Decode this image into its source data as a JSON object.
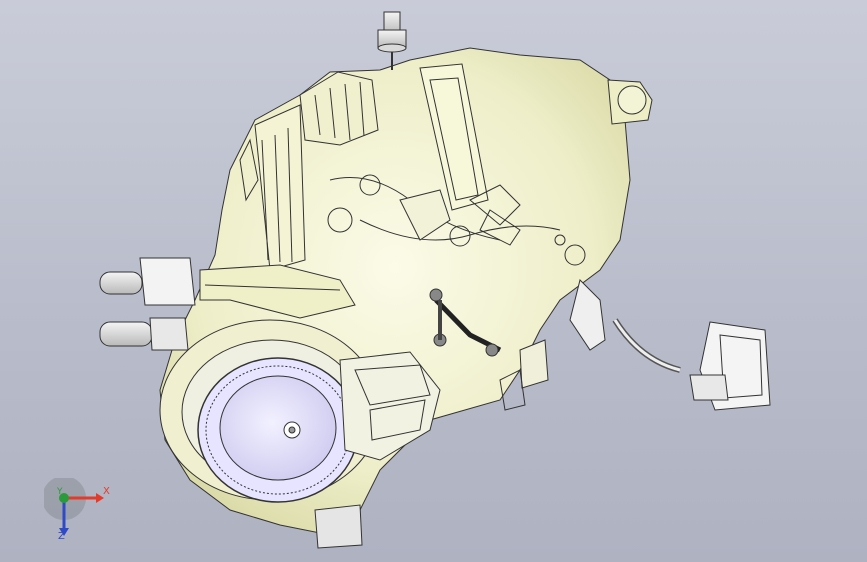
{
  "viewport": {
    "background_top": "#c9ccd8",
    "background_bottom": "#aeb2c1",
    "model_name_icon": "hvac-blower-assembly-icon"
  },
  "triad": {
    "x_label": "X",
    "y_label": "Y",
    "z_label": "Z",
    "x_color": "#e33b2b",
    "y_color": "#2a9b3a",
    "z_color": "#2f49c7"
  }
}
